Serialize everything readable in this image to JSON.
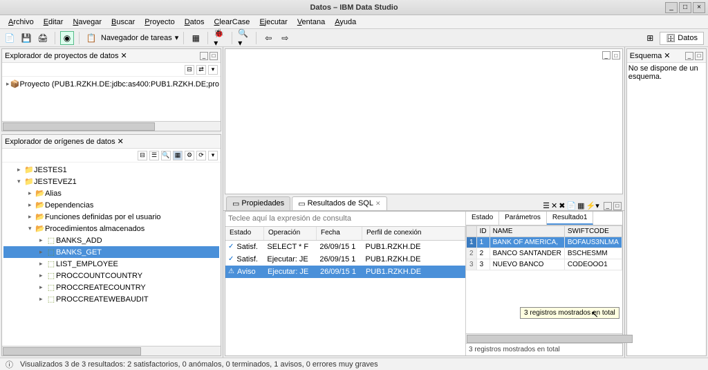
{
  "window": {
    "title": "Datos – IBM Data Studio"
  },
  "menus": [
    "Archivo",
    "Editar",
    "Navegar",
    "Buscar",
    "Proyecto",
    "Datos",
    "ClearCase",
    "Ejecutar",
    "Ventana",
    "Ayuda"
  ],
  "toolbar": {
    "task_nav": "Navegador de tareas"
  },
  "perspective": {
    "button": "Datos"
  },
  "panes": {
    "project_explorer": {
      "title": "Explorador de proyectos de datos",
      "item": "Proyecto (PUB1.RZKH.DE:jdbc:as400:PUB1.RZKH.DE;pro"
    },
    "source_explorer": {
      "title": "Explorador de orígenes de datos"
    },
    "schema": {
      "title": "Esquema",
      "text": "No se dispone de un esquema."
    }
  },
  "tree": {
    "items": [
      {
        "depth": 1,
        "caret": "▸",
        "icon": "📁",
        "label": "JESTES1"
      },
      {
        "depth": 1,
        "caret": "▾",
        "icon": "📁",
        "label": "JESTEVEZ1"
      },
      {
        "depth": 2,
        "caret": "▸",
        "icon": "📂",
        "label": "Alias"
      },
      {
        "depth": 2,
        "caret": "▸",
        "icon": "📂",
        "label": "Dependencias"
      },
      {
        "depth": 2,
        "caret": "▸",
        "icon": "📂",
        "label": "Funciones definidas por el usuario"
      },
      {
        "depth": 2,
        "caret": "▾",
        "icon": "📂",
        "label": "Procedimientos almacenados"
      },
      {
        "depth": 3,
        "caret": "▸",
        "icon": "⬚",
        "label": "BANKS_ADD"
      },
      {
        "depth": 3,
        "caret": "▸",
        "icon": "⬚",
        "label": "BANKS_GET",
        "sel": true
      },
      {
        "depth": 3,
        "caret": "▸",
        "icon": "⬚",
        "label": "LIST_EMPLOYEE"
      },
      {
        "depth": 3,
        "caret": "▸",
        "icon": "⬚",
        "label": "PROCCOUNTCOUNTRY"
      },
      {
        "depth": 3,
        "caret": "▸",
        "icon": "⬚",
        "label": "PROCCREATECOUNTRY"
      },
      {
        "depth": 3,
        "caret": "▸",
        "icon": "⬚",
        "label": "PROCCREATEWEBAUDIT"
      }
    ]
  },
  "bottom": {
    "tabs": {
      "props": "Propiedades",
      "sql": "Resultados de SQL"
    },
    "query_placeholder": "Teclee aquí la expresión de consulta",
    "headers": {
      "estado": "Estado",
      "op": "Operación",
      "fecha": "Fecha",
      "perfil": "Perfil de conexión"
    },
    "rows": [
      {
        "status": "✓",
        "kind": "Satisf.",
        "op": "SELECT * F",
        "date": "26/09/15 1",
        "profile": "PUB1.RZKH.DE"
      },
      {
        "status": "✓",
        "kind": "Satisf.",
        "op": "Ejecutar: JE",
        "date": "26/09/15 1",
        "profile": "PUB1.RZKH.DE"
      },
      {
        "status": "⚠",
        "kind": "Aviso",
        "op": "Ejecutar: JE",
        "date": "26/09/15 1",
        "profile": "PUB1.RZKH.DE",
        "sel": true
      }
    ],
    "subtabs": {
      "estado": "Estado",
      "params": "Parámetros",
      "result": "Resultado1"
    },
    "grid": {
      "cols": [
        "ID",
        "NAME",
        "SWIFTCODE"
      ],
      "data": [
        {
          "n": "1",
          "id": "1",
          "name": "BANK OF AMERICA,",
          "swift": "BOFAUS3NLMA",
          "sel": true
        },
        {
          "n": "2",
          "id": "2",
          "name": "BANCO SANTANDER",
          "swift": "BSCHESMM"
        },
        {
          "n": "3",
          "id": "3",
          "name": "NUEVO BANCO",
          "swift": "CODEOOO1"
        }
      ]
    },
    "grid_status": "3 registros mostrados en total",
    "tooltip": "3 registros mostrados en total"
  },
  "statusbar": "Visualizados 3 de 3 resultados: 2 satisfactorios, 0 anómalos, 0 terminados, 1 avisos, 0 errores muy graves"
}
